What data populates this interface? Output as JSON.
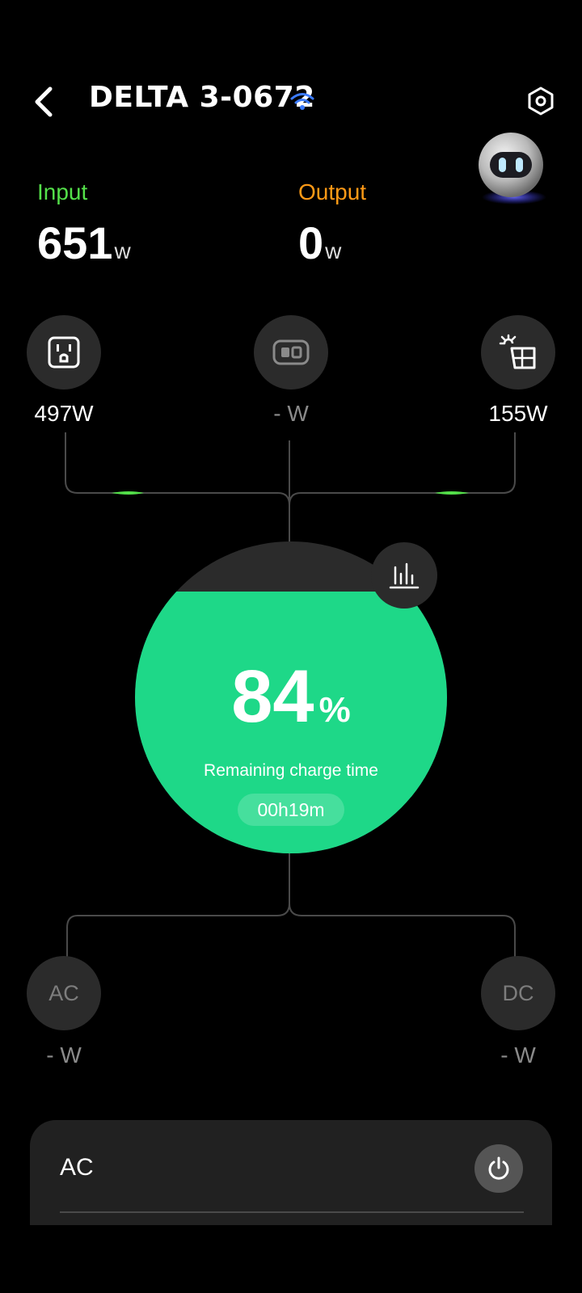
{
  "header": {
    "title": "DELTA 3-0672",
    "icons": {
      "back": "chevron-left-icon",
      "wifi": "wifi-icon",
      "settings": "settings-hex-icon",
      "assistant": "robot-avatar"
    }
  },
  "stats": {
    "input": {
      "label": "Input",
      "value": "651",
      "unit": "w"
    },
    "output": {
      "label": "Output",
      "value": "0",
      "unit": "w"
    }
  },
  "inputs": {
    "ac_in": {
      "icon": "ac-outlet-icon",
      "value": "497W"
    },
    "car_in": {
      "icon": "car-port-icon",
      "value": "- W"
    },
    "solar_in": {
      "icon": "solar-panel-icon",
      "value": "155W"
    }
  },
  "battery": {
    "percent": "84",
    "percent_symbol": "%",
    "charge_label": "Remaining charge time",
    "charge_time": "00h19m",
    "level": 0.84
  },
  "outputs": {
    "ac_out": {
      "label": "AC",
      "value": "- W"
    },
    "dc_out": {
      "label": "DC",
      "value": "- W"
    }
  },
  "ac_card": {
    "label": "AC",
    "power_icon": "power-icon"
  },
  "colors": {
    "input": "#54e04a",
    "output": "#ff9a16",
    "battery": "#1ed888",
    "wifi": "#3b7bff"
  }
}
